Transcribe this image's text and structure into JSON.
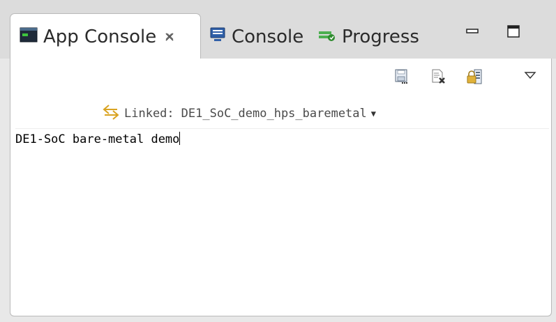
{
  "tabs": {
    "app_console": {
      "label": "App Console",
      "close_glyph": "✘",
      "icon": "terminal-icon"
    },
    "console": {
      "label": "Console",
      "icon": "monitor-icon"
    },
    "progress": {
      "label": "Progress",
      "icon": "progress-icon"
    }
  },
  "window_controls": {
    "minimize": "minimize-icon",
    "maximize": "maximize-icon"
  },
  "toolbar": {
    "icons": [
      "save-icon",
      "clear-console-icon",
      "scroll-lock-icon",
      "view-menu-icon"
    ]
  },
  "linked": {
    "label": "Linked:",
    "target": "DE1_SoC_demo_hps_baremetal",
    "icon": "link-arrows-icon"
  },
  "console": {
    "output": "DE1-SoC bare-metal demo"
  },
  "colors": {
    "accent_link": "#d9a321",
    "background": "#e8e8e8",
    "panel": "#ffffff"
  }
}
